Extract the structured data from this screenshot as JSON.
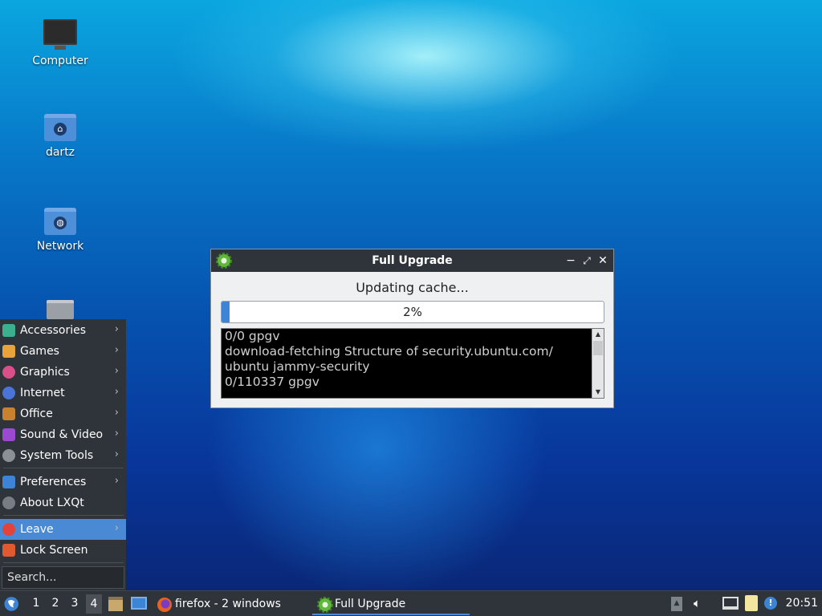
{
  "desktop": {
    "icons": [
      {
        "label": "Computer"
      },
      {
        "label": "dartz"
      },
      {
        "label": "Network"
      }
    ]
  },
  "dialog": {
    "title": "Full Upgrade",
    "status": "Updating cache...",
    "progress_percent": 2,
    "progress_label": "2%",
    "log_lines": [
      "0/0 gpgv",
      "download-fetching Structure of security.ubuntu.com/",
      "ubuntu jammy-security",
      "0/110337 gpgv"
    ]
  },
  "menu": {
    "items": [
      {
        "label": "Accessories",
        "icon": "accessories-icon",
        "color": "#3bb08f"
      },
      {
        "label": "Games",
        "icon": "games-icon",
        "color": "#e8a33a"
      },
      {
        "label": "Graphics",
        "icon": "graphics-icon",
        "color": "#d94f8a"
      },
      {
        "label": "Internet",
        "icon": "internet-icon",
        "color": "#4a74d8"
      },
      {
        "label": "Office",
        "icon": "office-icon",
        "color": "#c8822f"
      },
      {
        "label": "Sound & Video",
        "icon": "sound-video-icon",
        "color": "#9a4ad0"
      },
      {
        "label": "System Tools",
        "icon": "system-tools-icon",
        "color": "#8a9096"
      }
    ],
    "prefs": [
      {
        "label": "Preferences",
        "icon": "preferences-icon",
        "color": "#3d84d6"
      },
      {
        "label": "About LXQt",
        "icon": "about-icon",
        "color": "#777d83"
      }
    ],
    "leave": {
      "label": "Leave",
      "icon": "power-icon",
      "color": "#e0443c"
    },
    "lock": {
      "label": "Lock Screen",
      "icon": "lock-icon",
      "color": "#e05a30"
    },
    "search_placeholder": "Search..."
  },
  "taskbar": {
    "workspaces": [
      "1",
      "2",
      "3",
      "4"
    ],
    "current_workspace": "4",
    "tasks": [
      {
        "label": "firefox - 2 windows"
      },
      {
        "label": "Full Upgrade"
      }
    ],
    "clock": "20:51"
  }
}
